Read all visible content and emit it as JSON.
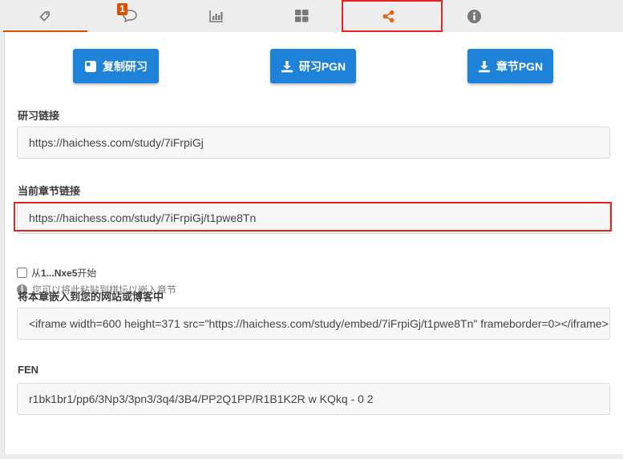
{
  "tabs": {
    "notification_count": "1",
    "items": [
      {
        "icon": "tag-icon"
      },
      {
        "icon": "chat-icon"
      },
      {
        "icon": "bar-chart-icon"
      },
      {
        "icon": "grid-icon"
      },
      {
        "icon": "share-icon"
      },
      {
        "icon": "info-icon"
      }
    ]
  },
  "buttons": {
    "clone_study": "复制研习",
    "study_pgn": "研习PGN",
    "chapter_pgn": "章节PGN"
  },
  "study_link": {
    "label": "研习链接",
    "value": "https://haichess.com/study/7iFrpiGj"
  },
  "chapter_link": {
    "label": "当前章节链接",
    "value": "https://haichess.com/study/7iFrpiGj/t1pwe8Tn",
    "start_from_prefix": "从",
    "start_from_move": "1...Nxe5",
    "start_from_suffix": "开始",
    "info": "您可以将此粘贴到棋坛以嵌入章节"
  },
  "embed": {
    "label": "将本章嵌入到您的网站或博客中",
    "value": "<iframe width=600 height=371 src=\"https://haichess.com/study/embed/7iFrpiGj/t1pwe8Tn\" frameborder=0></iframe>"
  },
  "fen": {
    "label": "FEN",
    "value": "r1bk1br1/pp6/3Np3/3pn3/3q4/3B4/PP2Q1PP/R1B1K2R w KQkq - 0 2"
  },
  "colors": {
    "accent": "#d85000",
    "button_blue": "#1d82d8",
    "highlight_red": "#e8231e"
  }
}
